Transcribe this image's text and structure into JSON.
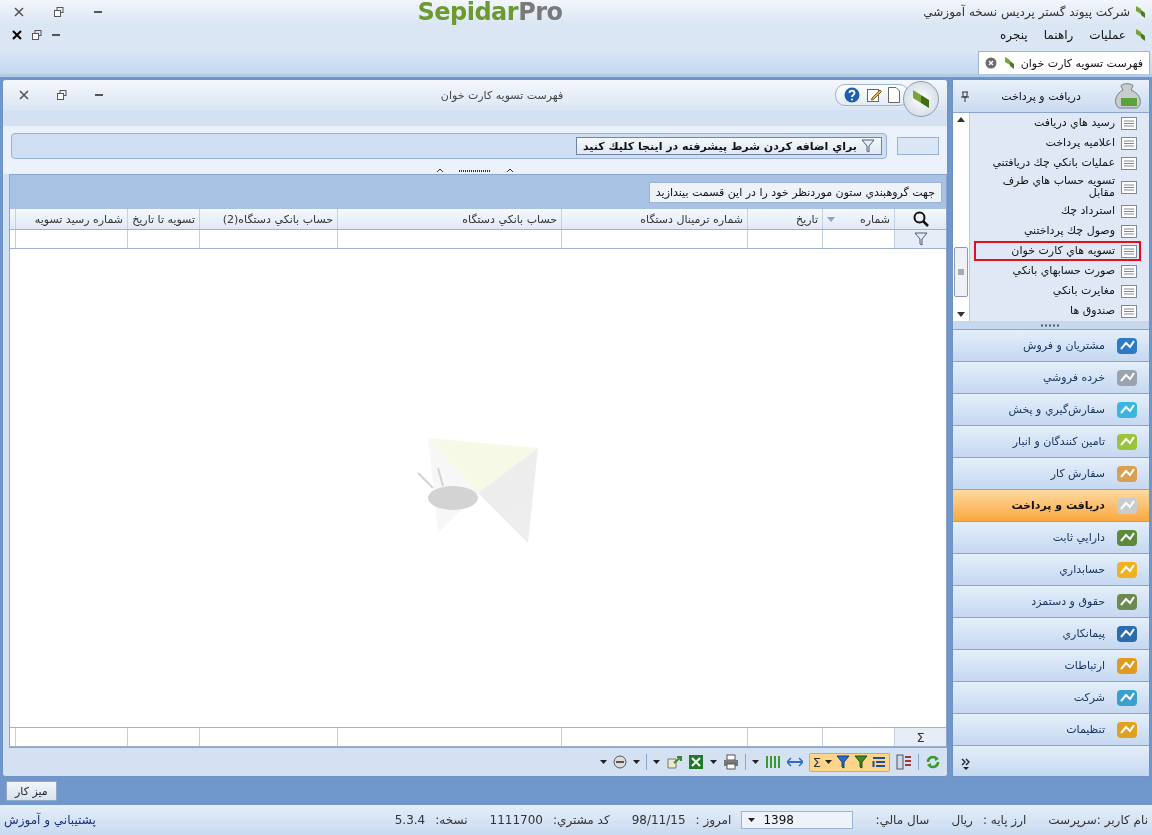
{
  "app": {
    "title": "شرکت پیوند گستر پردیس نسخه آموزشي",
    "logo_main": "Sepidar",
    "logo_suffix": "Pro"
  },
  "menu": [
    "عمليات",
    "راهنما",
    "پنجره"
  ],
  "doc_tab": {
    "label": "فهرست تسويه كارت خوان",
    "selected": true
  },
  "form": {
    "title": "فهرست تسويه كارت خوان",
    "filter_hint": "براي اضافه كردن شرط پيشرفته در اينجا كليك كنيد",
    "group_hint": "جهت گروهبندي ستون موردنظر خود را در اين قسمت بيندازيد",
    "columns": [
      "شماره",
      "تاريخ",
      "شماره ترمينال دستگاه",
      "حساب بانكي دستگاه",
      "حساب بانكي دستگاه(2)",
      "تسويه تا تاريخ",
      "شماره رسيد تسويه"
    ],
    "summary_symbol": "Σ",
    "toolbar_sum_symbol": "Σ"
  },
  "nav": {
    "title": "دريافت و پرداخت",
    "items": [
      {
        "label": "رسيد هاي دريافت",
        "highlighted": false
      },
      {
        "label": "اعلاميه پرداخت",
        "highlighted": false
      },
      {
        "label": "عمليات بانكي چك دريافتني",
        "highlighted": false
      },
      {
        "label": "تسويه حساب هاي طرف مقابل",
        "highlighted": false
      },
      {
        "label": "استرداد چك",
        "highlighted": false
      },
      {
        "label": "وصول چك پرداختني",
        "highlighted": false
      },
      {
        "label": "تسويه هاي كارت خوان",
        "highlighted": true
      },
      {
        "label": "صورت حسابهاي بانكي",
        "highlighted": false
      },
      {
        "label": "مغايرت بانكي",
        "highlighted": false
      },
      {
        "label": "صندوق ها",
        "highlighted": false
      }
    ],
    "modules": [
      {
        "label": "مشتريان و فروش",
        "selected": false
      },
      {
        "label": "خرده فروشي",
        "selected": false
      },
      {
        "label": "سفارش‌گيري و پخش",
        "selected": false
      },
      {
        "label": "تامين كنندگان و انبار",
        "selected": false
      },
      {
        "label": "سفارش كار",
        "selected": false
      },
      {
        "label": "دريافت و پرداخت",
        "selected": true
      },
      {
        "label": "دارايي ثابت",
        "selected": false
      },
      {
        "label": "حسابداري",
        "selected": false
      },
      {
        "label": "حقوق و دستمزد",
        "selected": false
      },
      {
        "label": "پيمانكاري",
        "selected": false
      },
      {
        "label": "ارتباطات",
        "selected": false
      },
      {
        "label": "شركت",
        "selected": false
      },
      {
        "label": "تنظيمات",
        "selected": false
      }
    ]
  },
  "taskbar": {
    "button": "ميز كار"
  },
  "status_bar": {
    "user": "نام كاربر :سرپرست",
    "currency_label": "ارز پايه :",
    "currency": "ريال",
    "fiscal_year_label": "سال مالي:",
    "fiscal_year": "1398",
    "today_label": "امروز :",
    "today": "98/11/15",
    "customer_code_label": "كد مشتري:",
    "customer_code": "1111700",
    "version_label": "نسخه:",
    "version": "5.3.4",
    "support": "پشتيباني و آموزش"
  }
}
